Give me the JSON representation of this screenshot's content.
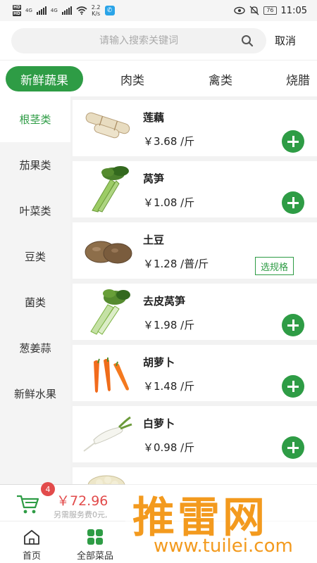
{
  "status_bar": {
    "hd1": "HD",
    "hd2": "HD",
    "net1": "4G",
    "net2": "4G",
    "speed_value": "2.2",
    "speed_unit": "K/s",
    "battery": "76",
    "time": "11:05",
    "icons": [
      "signal-icon",
      "wifi-icon",
      "app-notification-icon",
      "eye-icon",
      "mute-bell-icon",
      "battery-icon"
    ]
  },
  "search": {
    "placeholder": "请输入搜索关键词",
    "cancel_label": "取消"
  },
  "categories": {
    "active_index": 0,
    "items": [
      {
        "label": "新鲜蔬果"
      },
      {
        "label": "肉类"
      },
      {
        "label": "禽类"
      },
      {
        "label": "烧腊"
      }
    ]
  },
  "sidebar": {
    "active_index": 0,
    "items": [
      {
        "label": "根茎类"
      },
      {
        "label": "茄果类"
      },
      {
        "label": "叶菜类"
      },
      {
        "label": "豆类"
      },
      {
        "label": "菌类"
      },
      {
        "label": "葱姜蒜"
      },
      {
        "label": "新鲜水果"
      }
    ]
  },
  "products": [
    {
      "name": "莲藕",
      "price": "￥3.68 /斤",
      "action": "add",
      "image": "lotus-root"
    },
    {
      "name": "莴笋",
      "price": "￥1.08 /斤",
      "action": "add",
      "image": "celtuce"
    },
    {
      "name": "土豆",
      "price": "￥1.28 /普/斤",
      "action": "spec",
      "spec_label": "选规格",
      "image": "potato"
    },
    {
      "name": "去皮莴笋",
      "price": "￥1.98 /斤",
      "action": "add",
      "image": "peeled-celtuce"
    },
    {
      "name": "胡萝卜",
      "price": "￥1.48 /斤",
      "action": "add",
      "image": "carrot"
    },
    {
      "name": "白萝卜",
      "price": "￥0.98 /斤",
      "action": "add",
      "image": "white-radish"
    },
    {
      "name": "",
      "price": "",
      "action": "none",
      "image": "cauliflower"
    }
  ],
  "cart": {
    "badge": "4",
    "total": "￥72.96",
    "fee_note": "另需服务费0元,"
  },
  "tabbar": {
    "items": [
      {
        "label": "首页",
        "icon": "home-icon"
      },
      {
        "label": "全部菜品",
        "icon": "grid-icon"
      }
    ]
  },
  "watermark": {
    "chars": "推雷网",
    "url": "www.tuilei.com"
  },
  "colors": {
    "accent": "#2e9c45",
    "price_red": "#e24b4b",
    "watermark": "#f39a1e"
  }
}
